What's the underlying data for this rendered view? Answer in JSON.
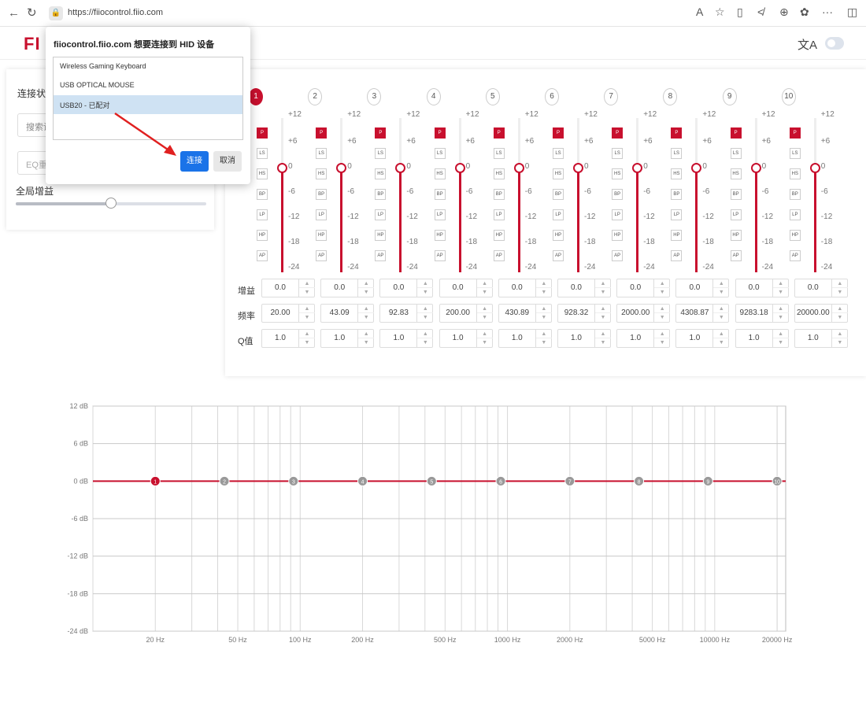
{
  "browser": {
    "url": "https://fiiocontrol.fiio.com",
    "icons": [
      "back-icon",
      "refresh-icon",
      "lock-icon",
      "read-aloud-icon",
      "favorite-icon",
      "split-screen-icon",
      "favorites-bar-icon",
      "collections-icon",
      "extensions-icon",
      "more-icon",
      "sidebar-icon"
    ]
  },
  "app": {
    "logo_text": "FI",
    "translate_icon": "文A"
  },
  "left_panel": {
    "connection_label": "连接状态",
    "search_placeholder": "搜索设",
    "eq_placeholder": "EQ重",
    "global_gain_label": "全局增益",
    "global_gain_level": 0.5
  },
  "bands": [
    {
      "num": "1",
      "gain": "0.0",
      "freq": "20.00",
      "q": "1.0",
      "active": true
    },
    {
      "num": "2",
      "gain": "0.0",
      "freq": "43.09",
      "q": "1.0",
      "active": false
    },
    {
      "num": "3",
      "gain": "0.0",
      "freq": "92.83",
      "q": "1.0",
      "active": false
    },
    {
      "num": "4",
      "gain": "0.0",
      "freq": "200.00",
      "q": "1.0",
      "active": false
    },
    {
      "num": "5",
      "gain": "0.0",
      "freq": "430.89",
      "q": "1.0",
      "active": false
    },
    {
      "num": "6",
      "gain": "0.0",
      "freq": "928.32",
      "q": "1.0",
      "active": false
    },
    {
      "num": "7",
      "gain": "0.0",
      "freq": "2000.00",
      "q": "1.0",
      "active": false
    },
    {
      "num": "8",
      "gain": "0.0",
      "freq": "4308.87",
      "q": "1.0",
      "active": false
    },
    {
      "num": "9",
      "gain": "0.0",
      "freq": "9283.18",
      "q": "1.0",
      "active": false
    },
    {
      "num": "10",
      "gain": "0.0",
      "freq": "20000.00",
      "q": "1.0",
      "active": false
    }
  ],
  "filter_types": [
    "P",
    "LS",
    "HS",
    "BP",
    "LP",
    "HP",
    "AP"
  ],
  "slider_scale": [
    "+12",
    "+6",
    "0",
    "-6",
    "-12",
    "-18",
    "-24"
  ],
  "row_labels": {
    "gain": "增益",
    "freq": "频率",
    "q": "Q值"
  },
  "colors": {
    "accent": "#c8102e",
    "button_blue": "#1a73e8",
    "selected_row": "#cfe2f3"
  },
  "dialog": {
    "title": "fiiocontrol.fiio.com 想要连接到 HID 设备",
    "devices": [
      "Wireless Gaming Keyboard",
      "USB OPTICAL MOUSE",
      "USB20 - 已配对"
    ],
    "selected_index": 2,
    "connect_label": "连接",
    "cancel_label": "取消"
  },
  "chart_data": {
    "type": "line",
    "title": "",
    "xlabel": "",
    "ylabel": "",
    "x_scale": "log",
    "xlim": [
      10,
      22000
    ],
    "ylim": [
      -24,
      12
    ],
    "y_ticks": [
      "12 dB",
      "6 dB",
      "0 dB",
      "-6 dB",
      "-12 dB",
      "-18 dB",
      "-24 dB"
    ],
    "y_tick_values": [
      12,
      6,
      0,
      -6,
      -12,
      -18,
      -24
    ],
    "x_ticks": [
      "20 Hz",
      "50 Hz",
      "100 Hz",
      "200 Hz",
      "500 Hz",
      "1000 Hz",
      "2000 Hz",
      "5000 Hz",
      "10000 Hz",
      "20000 Hz"
    ],
    "x_tick_values": [
      20,
      50,
      100,
      200,
      500,
      1000,
      2000,
      5000,
      10000,
      20000
    ],
    "grid": true,
    "series": [
      {
        "values_x": [
          10,
          22000
        ],
        "values_y": [
          0,
          0
        ]
      }
    ],
    "band_points": [
      {
        "label": "1",
        "x": 20,
        "y": 0
      },
      {
        "label": "2",
        "x": 43.09,
        "y": 0
      },
      {
        "label": "3",
        "x": 92.83,
        "y": 0
      },
      {
        "label": "4",
        "x": 200,
        "y": 0
      },
      {
        "label": "5",
        "x": 430.89,
        "y": 0
      },
      {
        "label": "6",
        "x": 928.32,
        "y": 0
      },
      {
        "label": "7",
        "x": 2000,
        "y": 0
      },
      {
        "label": "8",
        "x": 4308.87,
        "y": 0
      },
      {
        "label": "9",
        "x": 9283.18,
        "y": 0
      },
      {
        "label": "10",
        "x": 20000,
        "y": 0
      }
    ]
  }
}
